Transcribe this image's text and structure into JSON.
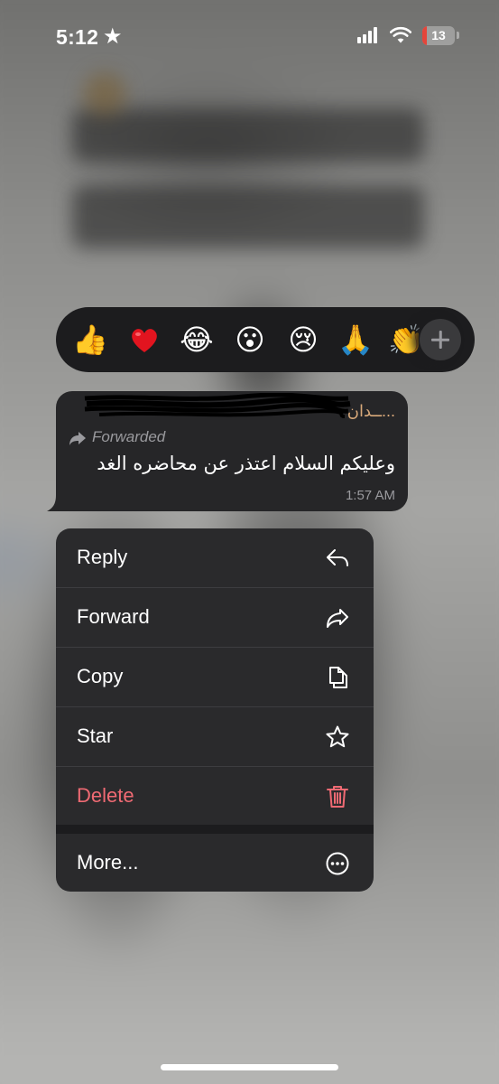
{
  "status_bar": {
    "time": "5:12",
    "battery_level": "13",
    "battery_fraction": 0.13,
    "colors": {
      "battery_low": "#e5453a"
    }
  },
  "reactions": [
    {
      "name": "thumbs-up",
      "glyph": "👍"
    },
    {
      "name": "red-heart",
      "glyph": "❤️"
    },
    {
      "name": "tears-of-joy",
      "glyph": "😂"
    },
    {
      "name": "surprised",
      "glyph": "😮"
    },
    {
      "name": "crying",
      "glyph": "😢"
    },
    {
      "name": "folded-hands",
      "glyph": "🙏"
    },
    {
      "name": "clapping-hands",
      "glyph": "👏"
    }
  ],
  "message": {
    "sender_name": "...ــدان",
    "forwarded_label": "Forwarded",
    "text": "وعليكم السلام اعتذر عن محاضره الغد",
    "time": "1:57 AM"
  },
  "menu": {
    "items": [
      {
        "label": "Reply",
        "icon": "reply-icon"
      },
      {
        "label": "Forward",
        "icon": "forward-icon"
      },
      {
        "label": "Copy",
        "icon": "copy-icon"
      },
      {
        "label": "Star",
        "icon": "star-icon"
      },
      {
        "label": "Delete",
        "icon": "trash-icon"
      }
    ],
    "more_label": "More...",
    "colors": {
      "destructive": "#ef6a73",
      "background": "#2a2a2c"
    }
  }
}
